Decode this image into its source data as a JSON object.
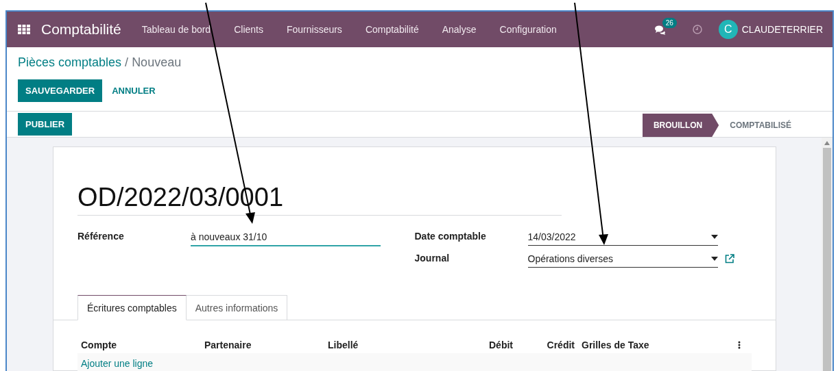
{
  "navbar": {
    "app_name": "Comptabilité",
    "menu": [
      "Tableau de bord",
      "Clients",
      "Fournisseurs",
      "Comptabilité",
      "Analyse",
      "Configuration"
    ],
    "messages_count": "26",
    "user": {
      "initial": "C",
      "name": "CLAUDETERRIER"
    }
  },
  "breadcrumb": {
    "parent": "Pièces comptables",
    "separator": "/",
    "current": "Nouveau"
  },
  "actions": {
    "save": "SAUVEGARDER",
    "discard": "ANNULER"
  },
  "header_buttons": [
    "PUBLIER"
  ],
  "stages": [
    {
      "label": "BROUILLON",
      "selected": true
    },
    {
      "label": "COMPTABILISÉ",
      "selected": false
    }
  ],
  "form": {
    "name": "OD/2022/03/0001",
    "left_fields": [
      {
        "label": "Référence",
        "value": "à nouveaux 31/10",
        "kind": "text"
      }
    ],
    "right_fields": [
      {
        "label": "Date comptable",
        "value": "14/03/2022",
        "kind": "select"
      },
      {
        "label": "Journal",
        "value": "Opérations diverses",
        "kind": "select_link"
      }
    ]
  },
  "tabs": [
    {
      "label": "Écritures comptables",
      "selected": true
    },
    {
      "label": "Autres informations",
      "selected": false
    }
  ],
  "table": {
    "columns": [
      {
        "label": "Compte",
        "numeric": false
      },
      {
        "label": "Partenaire",
        "numeric": false
      },
      {
        "label": "Libellé",
        "numeric": false
      },
      {
        "label": "Débit",
        "numeric": true
      },
      {
        "label": "Crédit",
        "numeric": true
      },
      {
        "label": "Grilles de Taxe",
        "numeric": false
      }
    ],
    "add_line": "Ajouter une ligne"
  }
}
